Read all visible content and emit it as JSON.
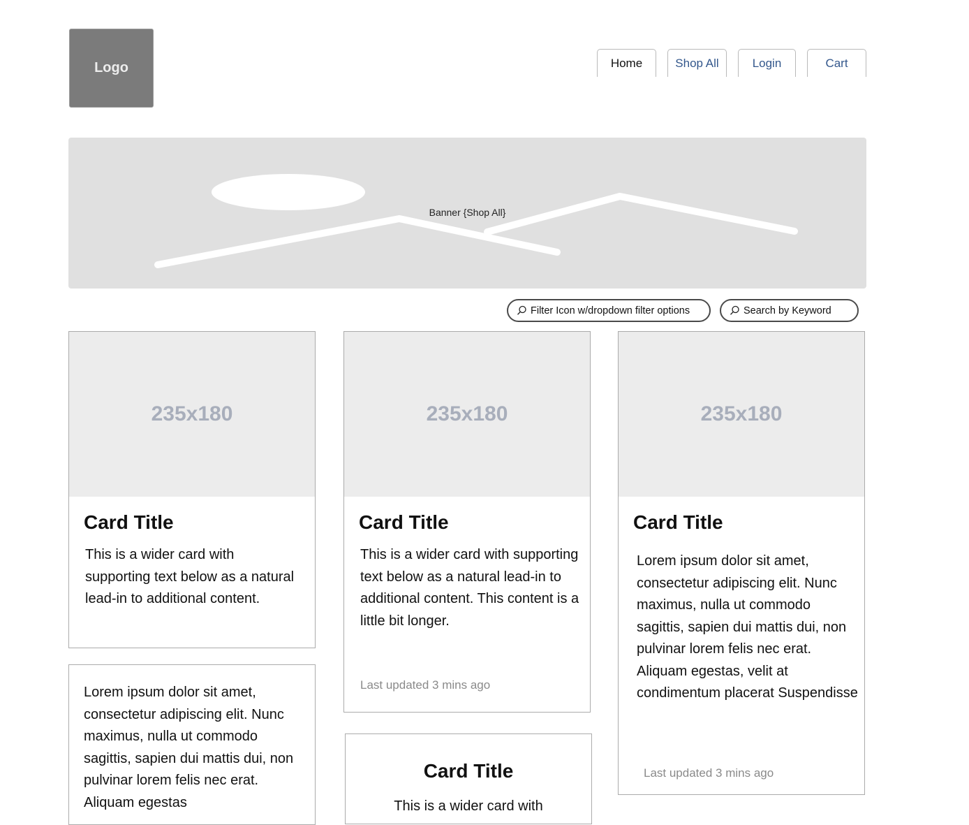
{
  "logo": {
    "label": "Logo"
  },
  "nav": {
    "tabs": [
      {
        "label": "Home",
        "active": true
      },
      {
        "label": "Shop All"
      },
      {
        "label": "Login"
      },
      {
        "label": "Cart"
      }
    ]
  },
  "banner": {
    "label": "Banner {Shop All}"
  },
  "filter": {
    "label": "Filter Icon w/dropdown filter options",
    "icon": "search-icon"
  },
  "search": {
    "label": "Search by Keyword",
    "icon": "search-icon"
  },
  "cards": [
    {
      "image_label": "235x180",
      "title": "Card Title",
      "text": "This is a wider card with supporting text below as a natural lead-in to additional content."
    },
    {
      "image_label": "235x180",
      "title": "Card Title",
      "text": "This is a wider card with supporting text below as a natural lead-in to additional content. This content is a little bit longer.",
      "updated": "Last updated 3 mins ago"
    },
    {
      "image_label": "235x180",
      "title": "Card Title",
      "text": "Lorem ipsum dolor sit amet, consectetur adipiscing elit. Nunc maximus, nulla ut commodo sagittis, sapien dui mattis dui, non pulvinar lorem felis nec erat. Aliquam egestas, velit at condimentum placerat Suspendisse",
      "updated": "Last updated 3 mins ago"
    },
    {
      "text": "Lorem ipsum dolor sit amet, consectetur adipiscing elit. Nunc maximus, nulla ut commodo sagittis, sapien dui mattis dui, non pulvinar lorem felis nec erat. Aliquam egestas"
    },
    {
      "title": "Card Title",
      "text": "This is a wider card with"
    }
  ],
  "colors": {
    "link": "#33578c",
    "logo_bg": "#7b7b7b",
    "banner_bg": "#e0e0e0",
    "image_placeholder_bg": "#ececec",
    "image_placeholder_text": "#a8aebb",
    "muted_text": "#8a8a8a"
  }
}
